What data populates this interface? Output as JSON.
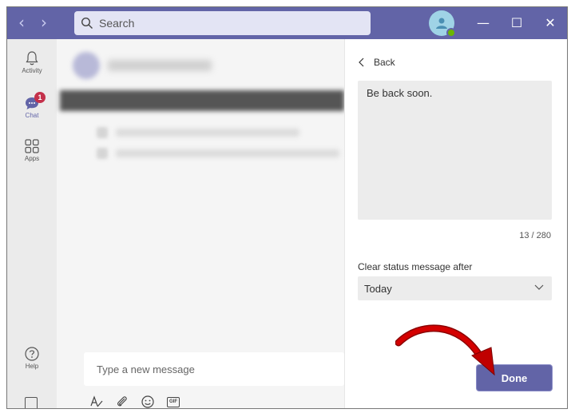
{
  "titlebar": {
    "search_placeholder": "Search",
    "back_arrow": "‹",
    "forward_arrow": "›",
    "minimize": "—",
    "maximize": "☐",
    "close": "✕"
  },
  "rail": {
    "items": [
      {
        "label": "Activity",
        "icon": "bell-icon"
      },
      {
        "label": "Chat",
        "icon": "chat-icon",
        "badge": "1"
      },
      {
        "label": "Apps",
        "icon": "apps-icon"
      },
      {
        "label": "Help",
        "icon": "help-icon"
      }
    ]
  },
  "compose": {
    "placeholder": "Type a new message",
    "tools": [
      "format-icon",
      "attach-icon",
      "emoji-icon",
      "gif-icon"
    ],
    "gif_label": "GIF"
  },
  "panel": {
    "back_label": "Back",
    "status_message": "Be back soon.",
    "counter": "13 / 280",
    "clear_label": "Clear status message after",
    "clear_value": "Today",
    "done_label": "Done"
  },
  "colors": {
    "brand": "#6264a7",
    "badge": "#c4314b",
    "annotation_arrow": "#c00000"
  }
}
